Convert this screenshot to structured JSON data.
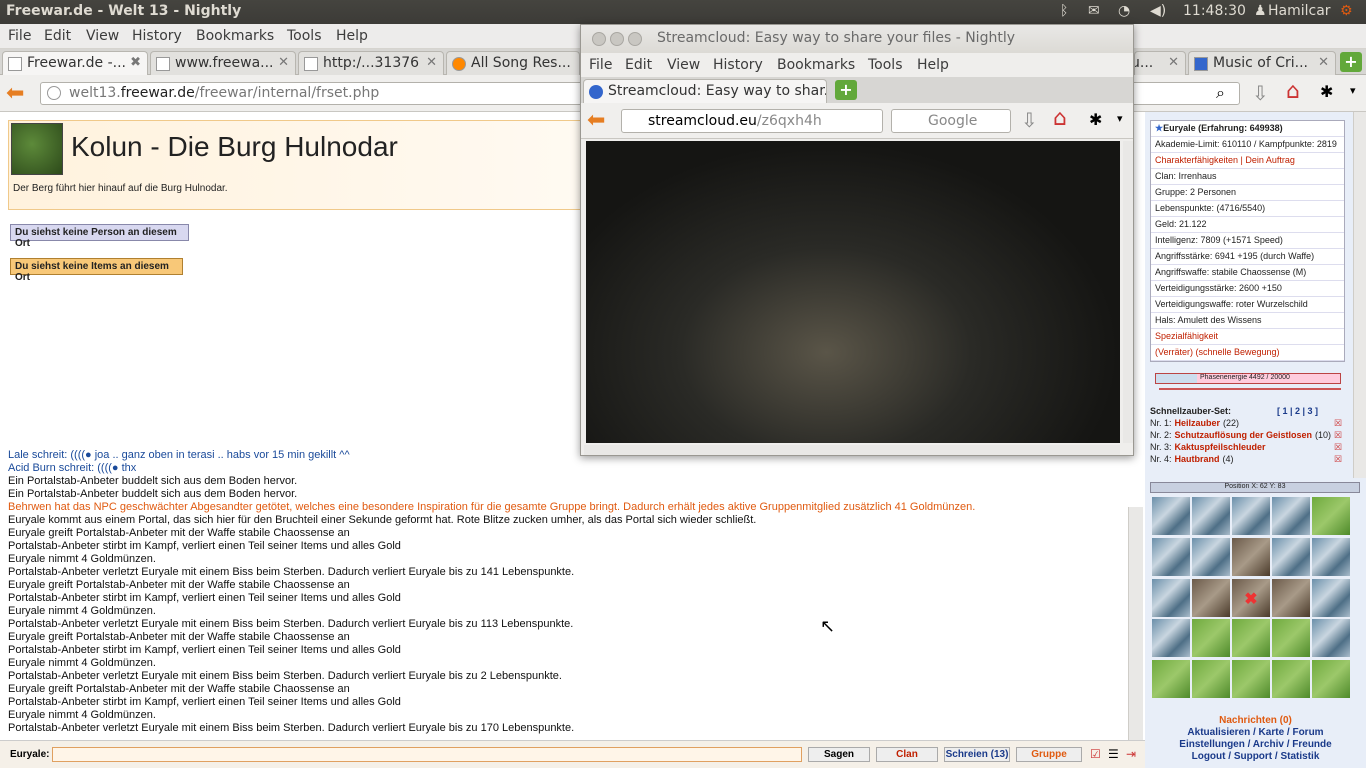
{
  "topbar": {
    "title": "Freewar.de - Welt 13 - Nightly",
    "time": "11:48:30",
    "user": "Hamilcar"
  },
  "menu": [
    "File",
    "Edit",
    "View",
    "History",
    "Bookmarks",
    "Tools",
    "Help"
  ],
  "tabs": [
    {
      "label": "Freewar.de -...",
      "active": true
    },
    {
      "label": "www.freewa..."
    },
    {
      "label": "http:/...31376"
    },
    {
      "label": "All Song Res..."
    },
    {
      "label": "...u..."
    },
    {
      "label": "Music of Cri..."
    }
  ],
  "url": {
    "host": "welt13.freewar.de",
    "path": "/freewar/internal/frset.php",
    "prefix": "welt13.",
    "domain": "freewar.de"
  },
  "place": {
    "title": "Kolun - Die Burg Hulnodar",
    "desc": "Der Berg führt hier hinauf auf die Burg Hulnodar.",
    "btn_persons": "Du siehst keine Person an diesem Ort",
    "btn_items": "Du siehst keine Items an diesem Ort"
  },
  "chat": [
    {
      "style": "blue",
      "text": "Lale schreit: ((((● joa .. ganz oben in terasi .. habs vor 15 min gekillt ^^"
    },
    {
      "style": "blue",
      "text": "Acid Burn schreit: ((((● thx"
    },
    {
      "style": "",
      "html": "<i>Ein <b>Portalstab-Anbeter</b> buddelt sich aus dem Boden hervor.</i>",
      "text": "Ein Portalstab-Anbeter buddelt sich aus dem Boden hervor."
    },
    {
      "style": "",
      "html": "<i>Ein <b>Portalstab-Anbeter</b> buddelt sich aus dem Boden hervor.</i>",
      "text": "Ein Portalstab-Anbeter buddelt sich aus dem Boden hervor."
    },
    {
      "style": "orange",
      "text": "Behrwen hat das NPC geschwächter Abgesandter getötet, welches eine besondere Inspiration für die gesamte Gruppe bringt. Dadurch erhält jedes aktive Gruppenmitglied zusätzlich 41 Goldmünzen."
    },
    {
      "style": "",
      "text": "Euryale kommt aus einem Portal, das sich hier für den Bruchteil einer Sekunde geformt hat. Rote Blitze zucken umher, als das Portal sich wieder schließt."
    },
    {
      "style": "",
      "text": "Euryale greift Portalstab-Anbeter mit der Waffe stabile Chaossense an"
    },
    {
      "style": "",
      "text": "Portalstab-Anbeter stirbt im Kampf, verliert einen Teil seiner Items und alles Gold"
    },
    {
      "style": "",
      "text": "Euryale nimmt 4 Goldmünzen."
    },
    {
      "style": "",
      "text": "Portalstab-Anbeter verletzt Euryale mit einem Biss beim Sterben. Dadurch verliert Euryale bis zu 141 Lebenspunkte."
    },
    {
      "style": "",
      "text": "Euryale greift Portalstab-Anbeter mit der Waffe stabile Chaossense an"
    },
    {
      "style": "",
      "text": "Portalstab-Anbeter stirbt im Kampf, verliert einen Teil seiner Items und alles Gold"
    },
    {
      "style": "",
      "text": "Euryale nimmt 4 Goldmünzen."
    },
    {
      "style": "",
      "text": "Portalstab-Anbeter verletzt Euryale mit einem Biss beim Sterben. Dadurch verliert Euryale bis zu 113 Lebenspunkte."
    },
    {
      "style": "",
      "text": "Euryale greift Portalstab-Anbeter mit der Waffe stabile Chaossense an"
    },
    {
      "style": "",
      "text": "Portalstab-Anbeter stirbt im Kampf, verliert einen Teil seiner Items und alles Gold"
    },
    {
      "style": "",
      "text": "Euryale nimmt 4 Goldmünzen."
    },
    {
      "style": "",
      "text": "Portalstab-Anbeter verletzt Euryale mit einem Biss beim Sterben. Dadurch verliert Euryale bis zu 2 Lebenspunkte."
    },
    {
      "style": "",
      "text": "Euryale greift Portalstab-Anbeter mit der Waffe stabile Chaossense an"
    },
    {
      "style": "",
      "text": "Portalstab-Anbeter stirbt im Kampf, verliert einen Teil seiner Items und alles Gold"
    },
    {
      "style": "",
      "text": "Euryale nimmt 4 Goldmünzen."
    },
    {
      "style": "",
      "text": "Portalstab-Anbeter verletzt Euryale mit einem Biss beim Sterben. Dadurch verliert Euryale bis zu 170 Lebenspunkte."
    }
  ],
  "bottom": {
    "label": "Euryale:",
    "sagen": "Sagen",
    "clan": "Clan",
    "schreien": "Schreien (13)",
    "gruppe": "Gruppe"
  },
  "side": {
    "header": "Euryale (Erfahrung: 649938)",
    "rows": [
      "Akademie-Limit: 610110 / Kampfpunkte: 2819",
      "Charakterfähigkeiten | Dein Auftrag",
      "Clan: Irrenhaus",
      "Gruppe: 2 Personen",
      "Lebenspunkte: (4716/5540)",
      "Geld: 21.122",
      "Intelligenz: 7809 (+1571 Speed)",
      "Angriffsstärke: 6941 +195 (durch Waffe)",
      "Angriffswaffe: stabile Chaossense (M)",
      "Verteidigungsstärke: 2600 +150",
      "Verteidigungswaffe: roter Wurzelschild",
      "Hals: Amulett des Wissens",
      "Spezialfähigkeit",
      "(Verräter) (schnelle Bewegung)"
    ],
    "phase": "Phasenenergie 4492 / 20000",
    "phase_fraction": 0.2246,
    "schnell": "Schnellzauber-Set:",
    "set_sel": "[ 1 | 2 | 3 ]",
    "spells": [
      {
        "nr": "Nr. 1:",
        "name": "Heilzauber",
        "cnt": "(22)"
      },
      {
        "nr": "Nr. 2:",
        "name": "Schutzauflösung der Geistlosen",
        "cnt": "(10)"
      },
      {
        "nr": "Nr. 3:",
        "name": "Kaktuspfeilschleuder",
        "cnt": ""
      },
      {
        "nr": "Nr. 4:",
        "name": "Hautbrand",
        "cnt": "(4)"
      }
    ],
    "position": "Position X: 62 Y: 83",
    "links": [
      "Nachrichten (0)",
      "Aktualisieren / Karte / Forum",
      "Einstellungen / Archiv / Freunde",
      "Logout / Support / Statistik"
    ]
  },
  "stream": {
    "title": "Streamcloud: Easy way to share your files - Nightly",
    "tab": "Streamcloud: Easy way to shar...",
    "url_host": "streamcloud.eu",
    "url_path": "/z6qxh4h",
    "search": "Google"
  }
}
